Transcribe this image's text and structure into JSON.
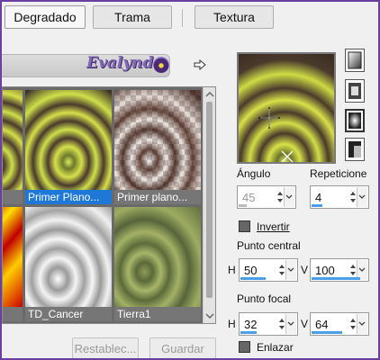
{
  "tabs": [
    {
      "label": "Degradado",
      "selected": true
    },
    {
      "label": "Trama",
      "selected": false
    },
    {
      "label": "Textura",
      "selected": false
    }
  ],
  "library": {
    "logo_text": "Evalynda",
    "thumbnails": [
      {
        "label": "...",
        "selected": false
      },
      {
        "label": "Primer Plano...",
        "selected": true
      },
      {
        "label": "Primer plano...",
        "selected": false
      },
      {
        "label": "...",
        "selected": false
      },
      {
        "label": "TD_Cancer",
        "selected": false
      },
      {
        "label": "Tierra1",
        "selected": false
      }
    ]
  },
  "buttons": {
    "reset_label": "Restablec...",
    "save_label": "Guardar"
  },
  "settings": {
    "angle_label": "Ángulo",
    "angle_value": "45",
    "repeats_label": "Repeticione",
    "repeats_value": "4",
    "invert_label": "Invertir",
    "center_label": "Punto central",
    "center_h_label": "H",
    "center_h_value": "50",
    "center_v_label": "V",
    "center_v_value": "100",
    "focal_label": "Punto focal",
    "focal_h_label": "H",
    "focal_h_value": "32",
    "focal_v_label": "V",
    "focal_v_value": "64",
    "link_label": "Enlazar"
  },
  "colors": {
    "frame_border": "#6b3fa0",
    "selection_blue": "#1e78d7",
    "gradient_yellow": "#d6e04a",
    "gradient_brown": "#4a3a2c"
  },
  "icons": [
    "arrow-right-icon",
    "linear-style-icon",
    "rectangular-style-icon",
    "sunburst-style-icon",
    "radial-style-icon",
    "crosshair-icon",
    "center-x-icon"
  ]
}
